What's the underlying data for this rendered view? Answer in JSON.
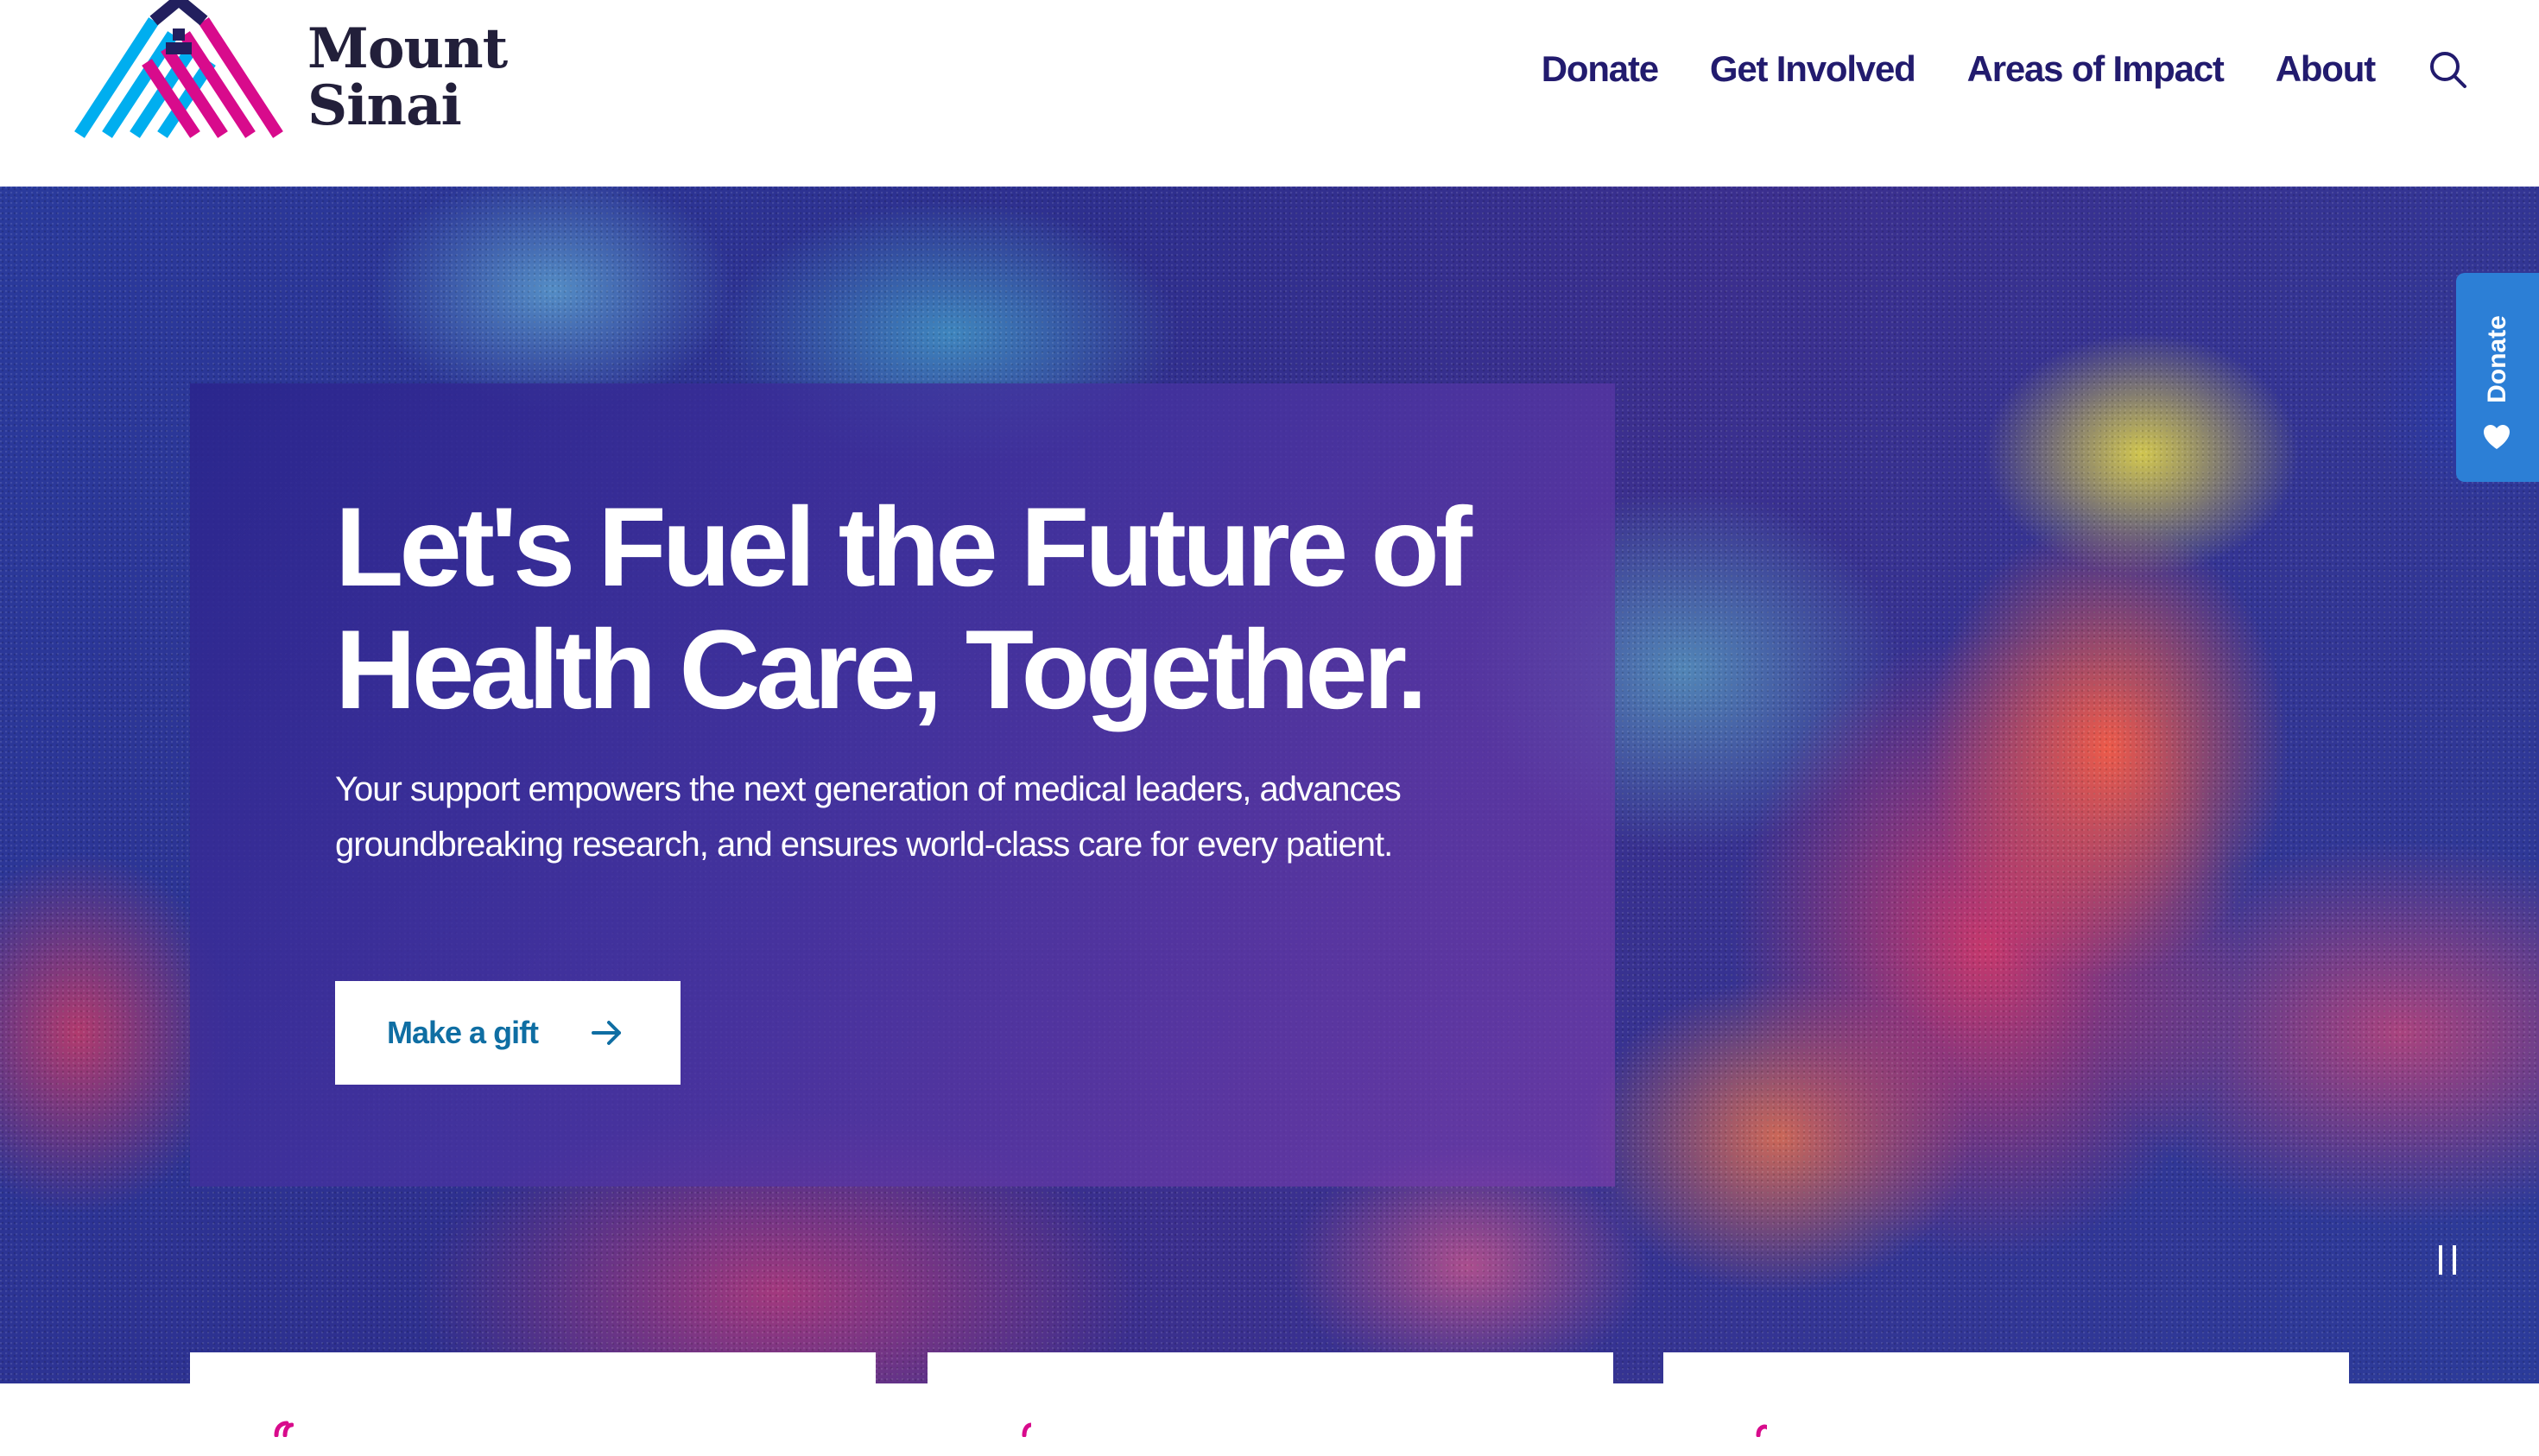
{
  "header": {
    "logo": {
      "line1": "Mount",
      "line2": "Sinai"
    },
    "nav": [
      {
        "label": "Donate"
      },
      {
        "label": "Get Involved"
      },
      {
        "label": "Areas of Impact"
      },
      {
        "label": "About"
      }
    ],
    "search_icon": "search-icon"
  },
  "hero": {
    "title": "Let's Fuel the Future of Health Care, Together.",
    "subtitle": "Your support empowers the next generation of medical leaders, advances groundbreaking research, and ensures world-class care for every patient.",
    "cta_label": "Make a gift",
    "cta_icon": "arrow-right-icon",
    "pause_icon": "pause-icon"
  },
  "side_tab": {
    "label": "Donate",
    "icon": "heart-icon",
    "color": "#2c7fd6"
  },
  "colors": {
    "brand_navy": "#221b6e",
    "cta_text": "#0f6ea3",
    "logo_cyan": "#00aeef",
    "logo_magenta": "#d80b8c",
    "logo_navy": "#221f5e"
  }
}
